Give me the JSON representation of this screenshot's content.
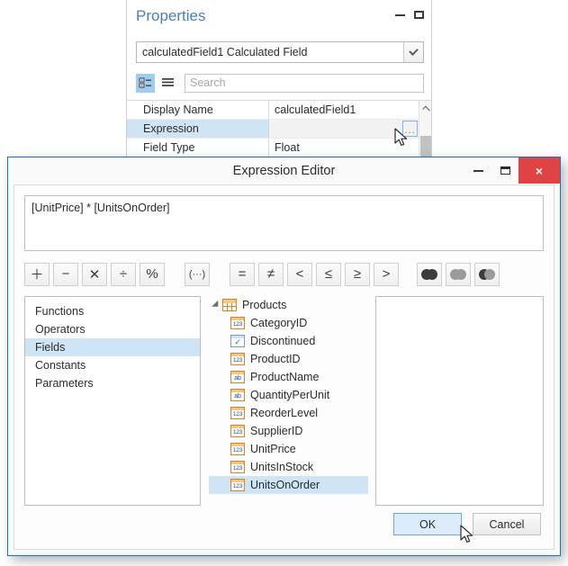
{
  "properties_window": {
    "title": "Properties",
    "minimize_label": "Minimize",
    "maximize_label": "Maximize",
    "object_selector": {
      "value": "calculatedField1  Calculated Field"
    },
    "toolbar": {
      "categorized_icon": "categorized-view-icon",
      "alphabetical_icon": "alphabetical-view-icon",
      "search_placeholder": "Search"
    },
    "grid": {
      "rows": [
        {
          "name": "Display Name",
          "value": "calculatedField1",
          "selected": false,
          "has_ellipsis": false
        },
        {
          "name": "Expression",
          "value": "",
          "selected": true,
          "has_ellipsis": true,
          "ellipsis_label": "..."
        },
        {
          "name": "Field Type",
          "value": "Float",
          "selected": false,
          "has_ellipsis": false
        }
      ]
    }
  },
  "expression_editor": {
    "title": "Expression Editor",
    "titlebar": {
      "minimize_label": "Minimize",
      "maximize_label": "Maximize",
      "close_label": "×"
    },
    "expression": "[UnitPrice] * [UnitsOnOrder]",
    "operator_buttons": [
      {
        "name": "add-operator-button",
        "glyph": "＋"
      },
      {
        "name": "subtract-operator-button",
        "glyph": "−"
      },
      {
        "name": "multiply-operator-button",
        "glyph": "✕"
      },
      {
        "name": "divide-operator-button",
        "glyph": "÷"
      },
      {
        "name": "modulo-operator-button",
        "glyph": "%"
      },
      {
        "name": "parentheses-button",
        "glyph": "(···)"
      },
      {
        "name": "equal-operator-button",
        "glyph": "="
      },
      {
        "name": "not-equal-operator-button",
        "glyph": "≠"
      },
      {
        "name": "less-than-operator-button",
        "glyph": "<"
      },
      {
        "name": "less-or-equal-operator-button",
        "glyph": "≤"
      },
      {
        "name": "greater-or-equal-operator-button",
        "glyph": "≥"
      },
      {
        "name": "greater-than-operator-button",
        "glyph": ">"
      },
      {
        "name": "and-operator-button",
        "glyph": ""
      },
      {
        "name": "or-operator-button",
        "glyph": ""
      },
      {
        "name": "not-operator-button",
        "glyph": ""
      }
    ],
    "categories": [
      {
        "label": "Functions",
        "selected": false
      },
      {
        "label": "Operators",
        "selected": false
      },
      {
        "label": "Fields",
        "selected": true
      },
      {
        "label": "Constants",
        "selected": false
      },
      {
        "label": "Parameters",
        "selected": false
      }
    ],
    "tree": {
      "root": {
        "label": "Products",
        "icon": "table-icon"
      },
      "children": [
        {
          "label": "CategoryID",
          "icon": "number-field-icon",
          "icon_text": "123",
          "type": "num",
          "selected": false
        },
        {
          "label": "Discontinued",
          "icon": "boolean-field-icon",
          "icon_text": "✓",
          "type": "bool",
          "selected": false
        },
        {
          "label": "ProductID",
          "icon": "number-field-icon",
          "icon_text": "123",
          "type": "num",
          "selected": false
        },
        {
          "label": "ProductName",
          "icon": "text-field-icon",
          "icon_text": "ab",
          "type": "txt",
          "selected": false
        },
        {
          "label": "QuantityPerUnit",
          "icon": "text-field-icon",
          "icon_text": "ab",
          "type": "txt",
          "selected": false
        },
        {
          "label": "ReorderLevel",
          "icon": "number-field-icon",
          "icon_text": "123",
          "type": "num",
          "selected": false
        },
        {
          "label": "SupplierID",
          "icon": "number-field-icon",
          "icon_text": "123",
          "type": "num",
          "selected": false
        },
        {
          "label": "UnitPrice",
          "icon": "number-field-icon",
          "icon_text": "123",
          "type": "num",
          "selected": false
        },
        {
          "label": "UnitsInStock",
          "icon": "number-field-icon",
          "icon_text": "123",
          "type": "num",
          "selected": false
        },
        {
          "label": "UnitsOnOrder",
          "icon": "number-field-icon",
          "icon_text": "123",
          "type": "num",
          "selected": true
        }
      ]
    },
    "description_panel": {
      "text": ""
    },
    "footer": {
      "ok_label": "OK",
      "cancel_label": "Cancel"
    }
  },
  "colors": {
    "accent_blue": "#1174c4",
    "selection_blue": "#cfe4f5",
    "close_red": "#e04343",
    "title_link_blue": "#4a7ebb",
    "field_icon_orange": "#d98228",
    "ok_button_bg": "#dcecfb"
  }
}
